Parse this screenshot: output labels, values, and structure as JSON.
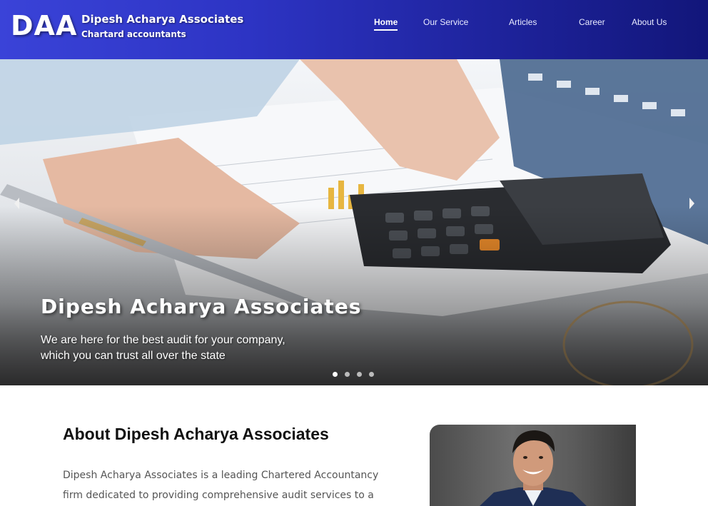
{
  "header": {
    "logo": "DAA",
    "brand_name": "Dipesh Acharya Associates",
    "brand_tagline": "Chartard accountants",
    "nav": [
      {
        "label": "Home",
        "active": true
      },
      {
        "label": "Our Service",
        "active": false
      },
      {
        "label": "Articles",
        "active": false
      },
      {
        "label": "Career",
        "active": false
      },
      {
        "label": "About Us",
        "active": false
      }
    ]
  },
  "hero": {
    "title": "Dipesh Acharya Associates",
    "subtitle_line1": "We are here for the best audit for your company,",
    "subtitle_line2": "which you can trust all over the state",
    "slide_count": 4,
    "active_slide": 1
  },
  "about": {
    "title": "About Dipesh Acharya Associates",
    "paragraph_line1": "Dipesh Acharya Associates is a leading Chartered Accountancy",
    "paragraph_line2": "firm dedicated to providing comprehensive audit services to a"
  },
  "colors": {
    "header_start": "#3a43d8",
    "header_end": "#12167a",
    "heading_text": "#111111",
    "body_text": "#555555"
  },
  "icons": {
    "prev": "chevron-left-icon",
    "next": "chevron-right-icon"
  }
}
